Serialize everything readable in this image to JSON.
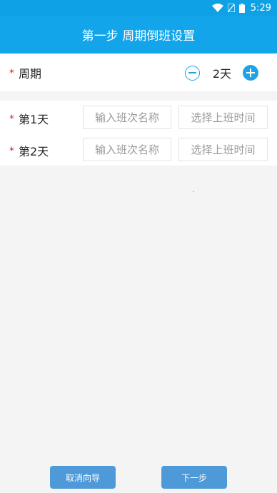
{
  "status_bar": {
    "time": "5:29",
    "icons": [
      "wifi-icon",
      "sim-icon",
      "battery-icon"
    ]
  },
  "app_bar": {
    "title": "第一步 周期倒班设置"
  },
  "cycle": {
    "required_mark": "*",
    "label": "周期",
    "value": "2天"
  },
  "days": [
    {
      "required_mark": "*",
      "label": "第1天",
      "name_placeholder": "输入班次名称",
      "time_placeholder": "选择上班时间"
    },
    {
      "required_mark": "*",
      "label": "第2天",
      "name_placeholder": "输入班次名称",
      "time_placeholder": "选择上班时间"
    }
  ],
  "footer": {
    "cancel_label": "取消向导",
    "next_label": "下一步"
  },
  "colors": {
    "primary": "#13a5ea",
    "button": "#4e9ad8",
    "required": "#e02020"
  }
}
